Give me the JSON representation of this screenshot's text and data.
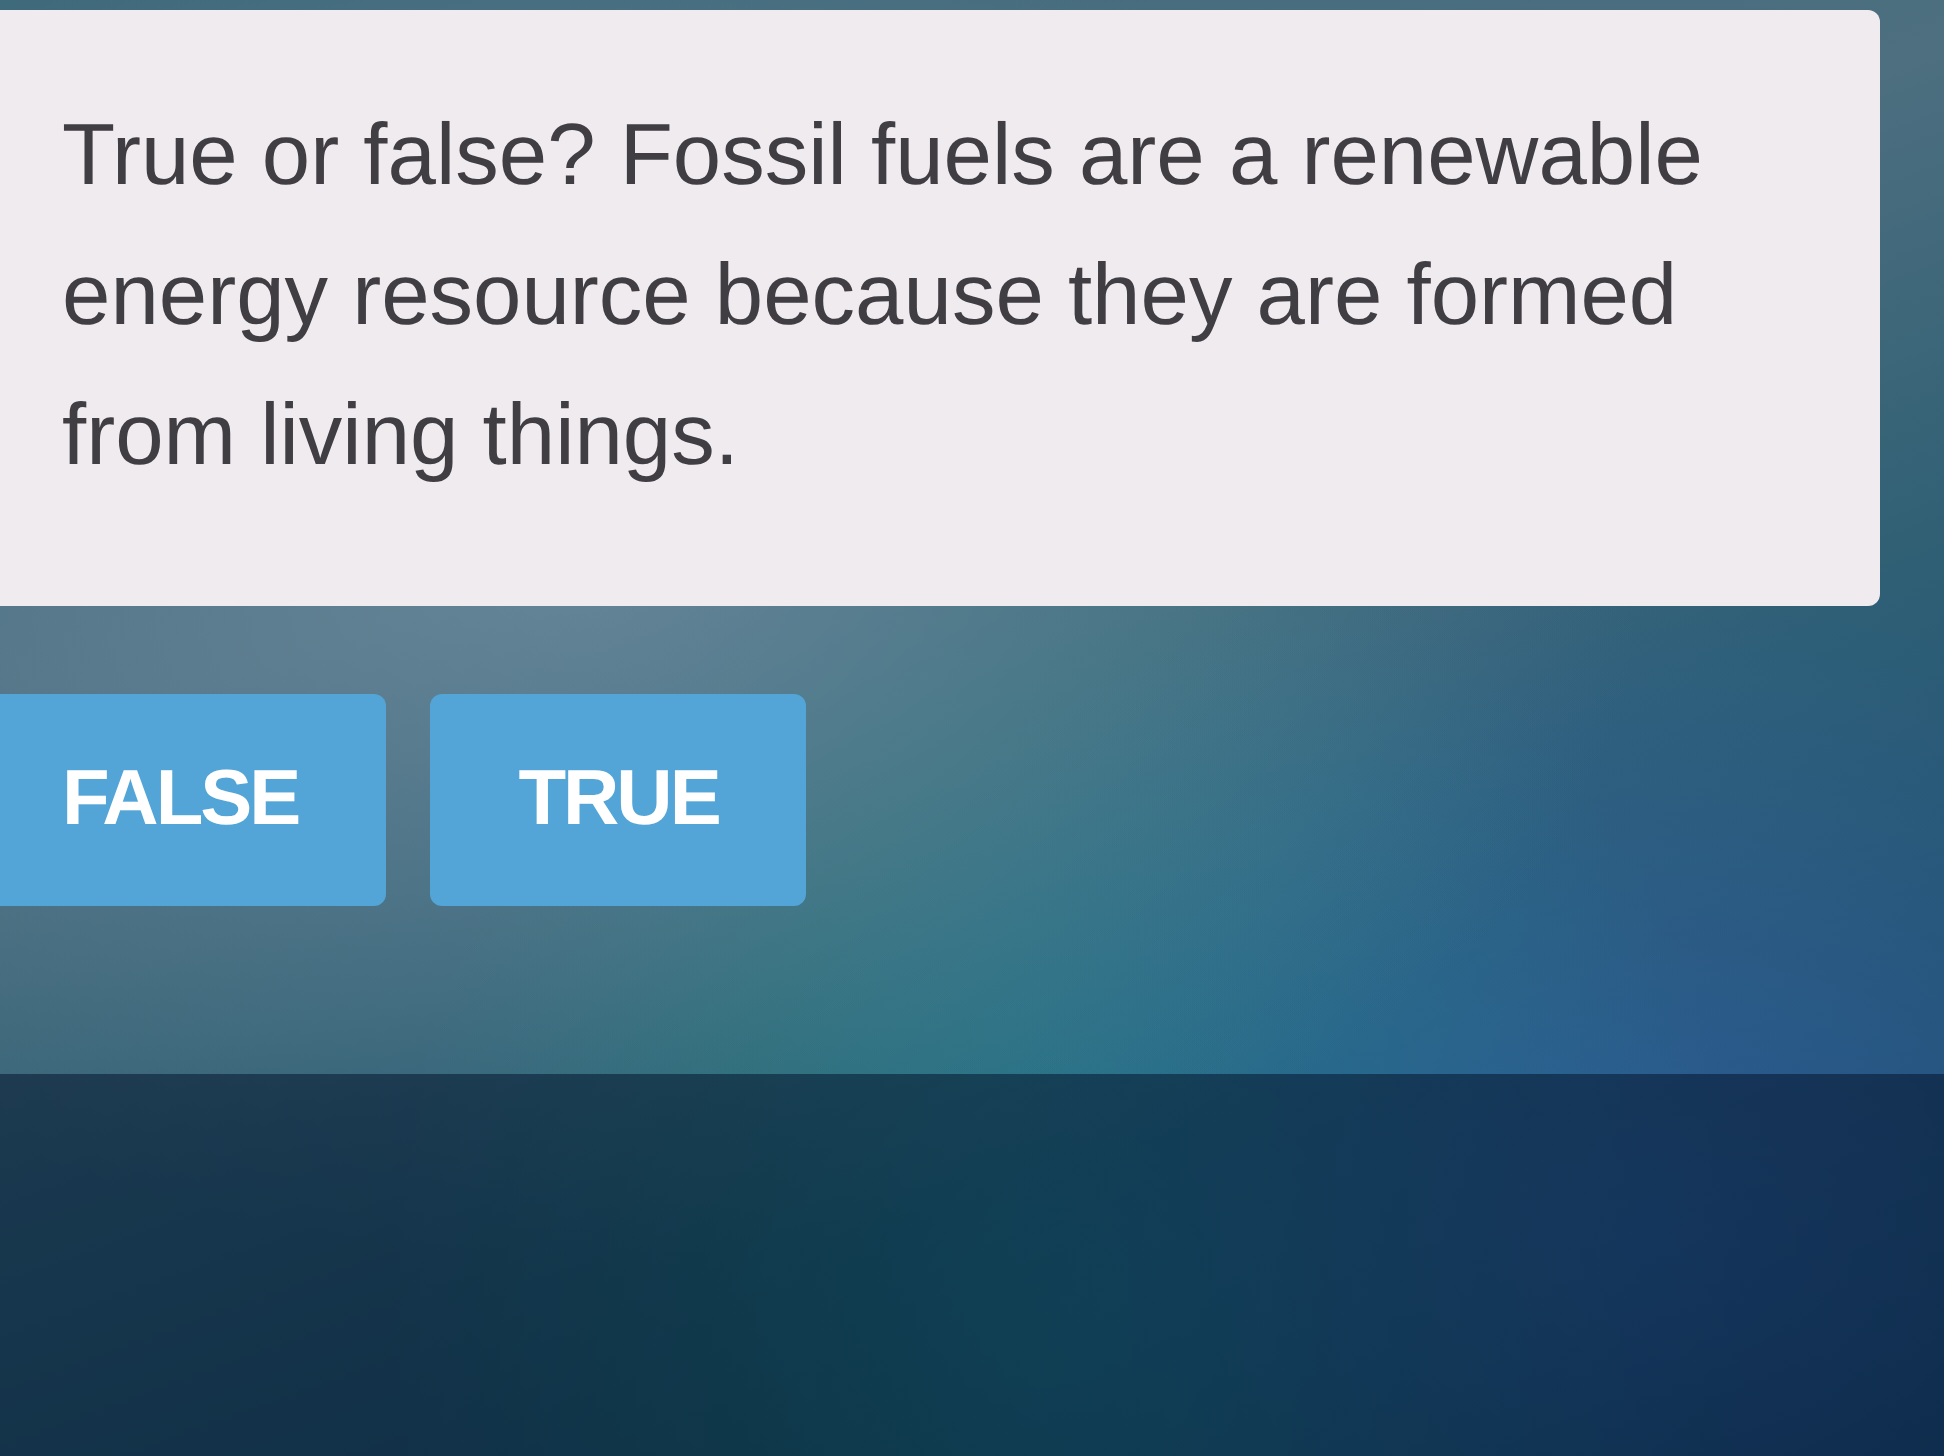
{
  "question": {
    "text": "True or false? Fossil fuels are a renewable energy resource because they are formed from living things."
  },
  "answers": [
    {
      "label": "FALSE",
      "selected": false
    },
    {
      "label": "TRUE",
      "selected": false
    }
  ]
}
